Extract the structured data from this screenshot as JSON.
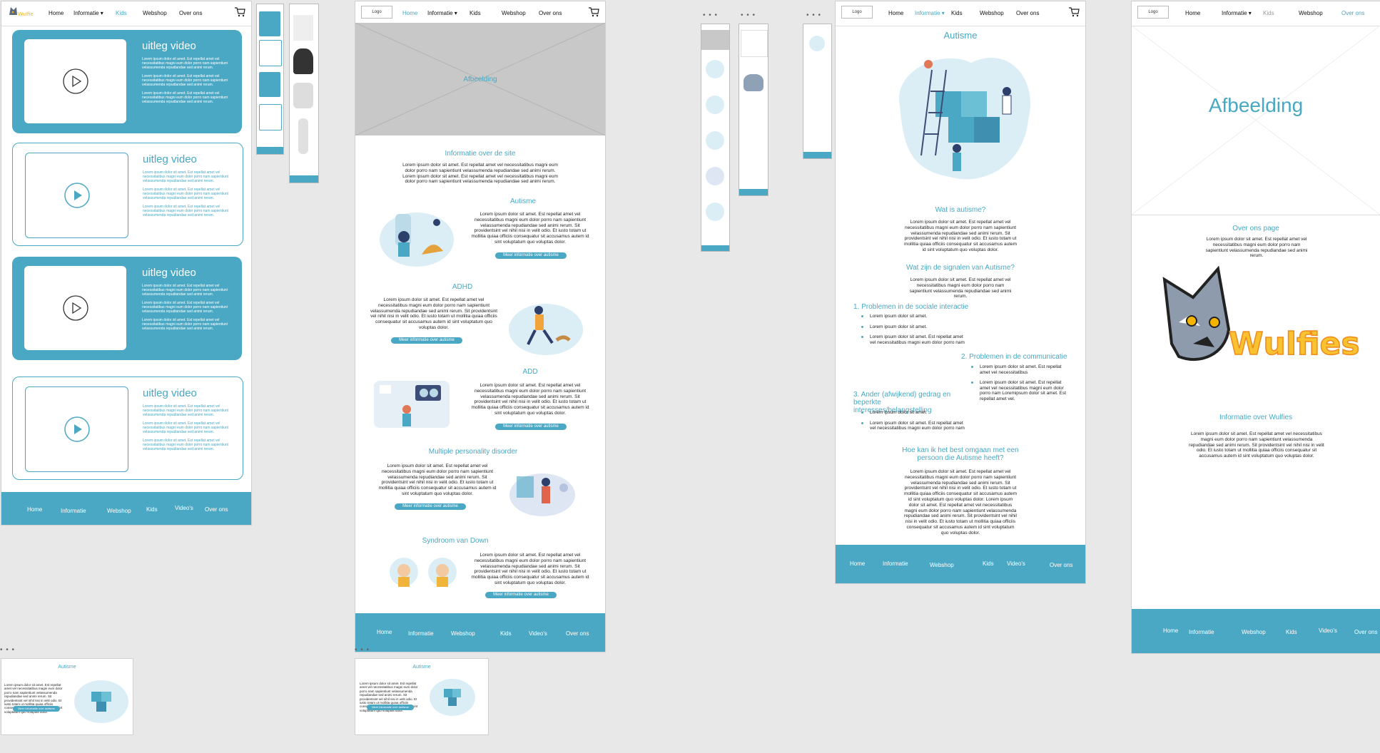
{
  "colors": {
    "accent": "#4ba8c4",
    "canvas": "#e8e8e8"
  },
  "nav": {
    "logo": "Logo",
    "home": "Home",
    "informatie": "Informatie ▾",
    "kids": "Kids",
    "webshop": "Webshop",
    "over_ons": "Over ons"
  },
  "footer": {
    "home": "Home",
    "informatie": "Informatie",
    "webshop": "Webshop",
    "kids": "Kids",
    "videos": "Video's",
    "over_ons": "Over ons"
  },
  "brand": {
    "logo_text": "Wulfies"
  },
  "videos_page": {
    "cards": [
      {
        "title": "uitleg video",
        "style": "filled"
      },
      {
        "title": "uitleg video",
        "style": "outline"
      },
      {
        "title": "uitleg video",
        "style": "filled"
      },
      {
        "title": "uitleg video",
        "style": "outline"
      }
    ],
    "body": "Lorem ipsum dolor sit amet. Est repellat amet vel necessitatibus magni eum dolor porro nam sapientiunt velassumenda repudiandae sed animi rerum."
  },
  "home_page": {
    "hero": "Afbeelding",
    "intro_title": "Informatie over de site",
    "intro_text": "Lorem ipsum dolor sit amet. Est repellat amet vel necessitatibus magni eum dolor porro nam sapientiunt velassumenda repudiandae sed animi rerum. Lorem ipsum dolor sit amet. Est repellat amet vel necessitatibus magni eum dolor porro nam sapientiunt velassumenda repudiandae sed animi rerum.",
    "section_text": "Lorem ipsum dolor sit amet. Est repellat amet vel necessitatibus magni eum dolor porro nam sapientiunt velassumenda repudiandae sed animi rerum. Sit providentsint vel nihil nisi in velit odio. Et iusto totam ut mollitia quiaa officiis consequatur sit accusamus autem id sint voluptatum quo voluptas dolor.",
    "sections": [
      {
        "title": "Autisme",
        "button": "Meer informatie over autisme"
      },
      {
        "title": "ADHD",
        "button": "Meer informatie over autisme"
      },
      {
        "title": "ADD",
        "button": "Meer informatie over autisme"
      },
      {
        "title": "Multiple personality disorder",
        "button": "Meer informatie over autisme"
      },
      {
        "title": "Syndroom van Down",
        "button": "Meer informatie over autisme"
      }
    ]
  },
  "autisme_page": {
    "title": "Autisme",
    "q1": "Wat is autisme?",
    "q1_text": "Lorem ipsum dolor sit amet. Est repellat amet vel necessitatibus magni eum dolor porro nam sapientiunt velassumenda repudiandae sed animi rerum. Sit providentsint vel nihil nisi in velit odio. Et iusto totam ut mollitia quiaa officiis consequatur sit accusamus autem id sint voluptatum quo voluptas dolor.",
    "q2": "Wat zijn de signalen van Autisme?",
    "q2_text": "Lorem ipsum dolor sit amet. Est repellat amet vel necessitatibus magni eum dolor porro nam sapientiunt velassumenda repudiandae sed animi rerum.",
    "l1_title": "1. Problemen in de sociale interactie",
    "l2_title": "2. Problemen in de communicatie",
    "l3_title": "3. Ander (afwijkend) gedrag en beperkte interesses/belangstelling",
    "bullet_short": "Lorem ipsum dolor sit amet.",
    "bullet_long": "Lorem ipsum dolor sit amet. Est repellat amet vel necessitatibus magni eum dolor porro nam",
    "bullet_mid": "Lorem ipsum dolor sit amet. Est repellat amet vel necessitatibus",
    "bullet_xl": "Lorem ipsum dolor sit amet. Est repellat amet vel necessitatibus magni eum dolor porro nam Loremipsum dolor sit amet. Est repellat amet vel.",
    "q3": "Hoe kan ik het best omgaan met een persoon die Autisme heeft?",
    "q3_text": "Lorem ipsum dolor sit amet. Est repellat amet vel necessitatibus magni eum dolor porro nam sapientiunt velassumenda repudiandae sed animi rerum. Sit providentsint vel nihil nisi in velit odio. Et iusto totam ut mollitia quiaa officiis consequatur sit accusamus autem id sint voluptatum quo voluptas dolor. Lorem ipsum dolor sit amet. Est repellat amet vel necessitatibus magni eum dolor porro nam sapientiunt velassumenda repudiandae sed animi rerum. Sit providentsint vel nihil nisi in velit odio. Et iusto totam ut mollitia quiaa officiis consequatur sit accusamus autem id sint voluptatum quo voluptas dolor."
  },
  "over_ons_page": {
    "hero": "Afbeelding",
    "title": "Over ons page",
    "text": "Lorem ipsum dolor sit amet. Est repellat amet vel necessitatibus magni eum dolor porro nam sapientiunt velassumenda repudiandae sed animi rerum.",
    "info_title": "Informatie  over Wulfies",
    "info_text": "Lorem ipsum dolor sit amet. Est repellat amet vel necessitatibus magni eum dolor porro nam sapientiunt velassumenda repudiandae sed animi rerum. Sit providentsint vel nihil nisi in velit odio. Et iusto totam ut mollitia quiaa officiis consequatur sit accusamus autem id sint voluptatum quo voluptas dolor."
  },
  "small_cards": {
    "title": "Autisme",
    "text": "Lorem ipsum dolor sit amet. Est repellat amet vel necessitatibus magni eum dolor porro nam sapientiunt velassumenda repudiandae sed animi rerum. Sit providentsint vel nihil nisi in velit odio. Et iusto totam ut mollitia quiaa officiis consequatur sit accusamus autem id sint voluptatum quo voluptas dolor.",
    "button": "Meer informatie over autisme"
  },
  "frame_dots": "• • •"
}
